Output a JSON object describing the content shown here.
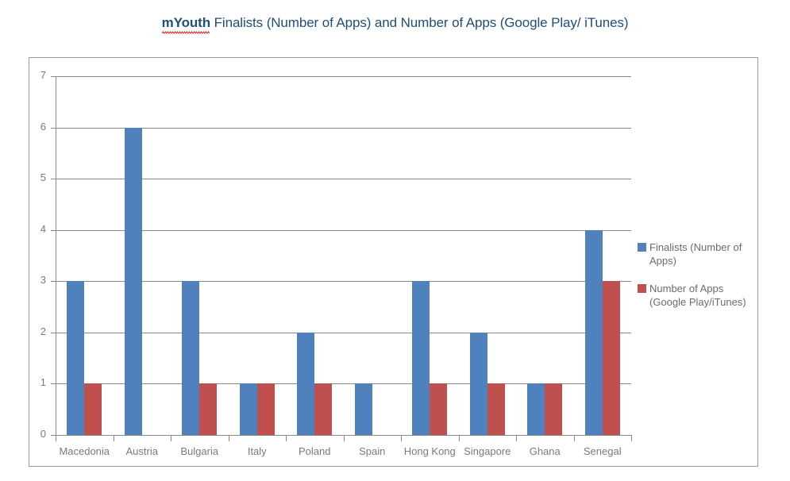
{
  "title": {
    "misspelled_word": "mYouth",
    "rest": " Finalists (Number of Apps) and Number of Apps (Google Play/ iTunes)",
    "color": "#1F4E79",
    "spellcheck_underline_color": "#E02020"
  },
  "legend": {
    "position": "right",
    "entries": [
      {
        "label": "Finalists (Number of Apps)",
        "color": "#4F81BD"
      },
      {
        "label": "Number of Apps (Google Play/iTunes)",
        "color": "#C0504D"
      }
    ]
  },
  "axis": {
    "y_ticks": [
      "0",
      "1",
      "2",
      "3",
      "4",
      "5",
      "6",
      "7"
    ],
    "tick_color": "#7a7a7a",
    "gridline_color": "#898989"
  },
  "chart_data": {
    "type": "bar",
    "title": "mYouth Finalists (Number of Apps) and Number of Apps (Google Play/ iTunes)",
    "xlabel": "",
    "ylabel": "",
    "ylim": [
      0,
      7
    ],
    "ytick_step": 1,
    "grid": true,
    "legend_position": "right",
    "categories": [
      "Macedonia",
      "Austria",
      "Bulgaria",
      "Italy",
      "Poland",
      "Spain",
      "Hong Kong",
      "Singapore",
      "Ghana",
      "Senegal"
    ],
    "series": [
      {
        "name": "Finalists (Number of Apps)",
        "color": "#4F81BD",
        "values": [
          3,
          6,
          3,
          1,
          2,
          1,
          3,
          2,
          1,
          4
        ]
      },
      {
        "name": "Number of Apps (Google Play/iTunes)",
        "color": "#C0504D",
        "values": [
          1,
          0,
          1,
          1,
          1,
          0,
          1,
          1,
          1,
          3
        ]
      }
    ]
  }
}
